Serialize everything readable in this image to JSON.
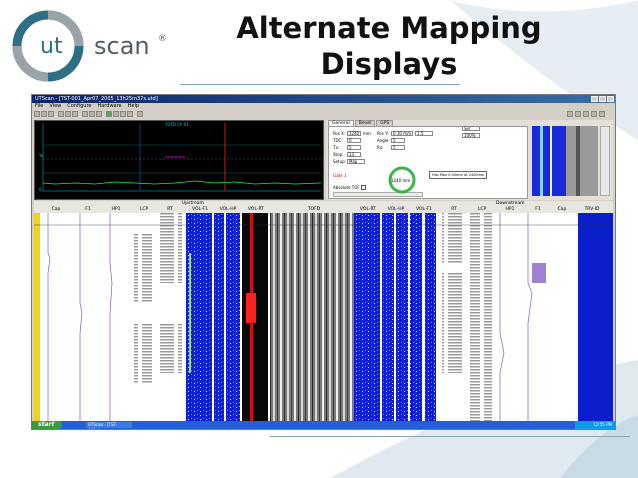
{
  "logo": {
    "ut": "ut",
    "scan": "scan",
    "reg": "®"
  },
  "slide": {
    "title_line1": "Alternate Mapping",
    "title_line2": "Displays"
  },
  "window": {
    "title": "UTScan - [TST-001_Apr07_2005_13h25m37s.utd]",
    "menu": [
      "File",
      "View",
      "Configure",
      "Hardware",
      "Help"
    ]
  },
  "panel": {
    "tabs": [
      "General",
      "Bevel",
      "GPS"
    ],
    "pos_x": {
      "label": "Pos X:",
      "value": "1240",
      "unit": "mm"
    },
    "pos_y": {
      "label": "Pos Y:",
      "value": "0.10 mm",
      "extra": "1.5"
    },
    "tdc": {
      "label": "TDC:",
      "value": "0"
    },
    "angle": {
      "label": "Angle:",
      "value": "5"
    },
    "tx": {
      "label": "Tx:",
      "value": "5"
    },
    "rx": {
      "label": "Rx:",
      "value": "5"
    },
    "step": {
      "label": "Step:",
      "value": "13"
    },
    "setup": {
      "label": "Setup:",
      "value": "Map"
    },
    "gate": "Gate 1",
    "absolute_tof": "Absolute TOF",
    "dial_value": "1240 mm",
    "dial_color": "#3ab54a",
    "info_box": "Hits Max 0.00mm at 2400mm",
    "dropdown1": "Sel",
    "dropdown2": "100%"
  },
  "scope": {
    "label_top": "TOFD Ch 01",
    "grid_color": "#00d0d0",
    "trace_color": "#00ff40"
  },
  "channels": {
    "group_upstream": "Upstream",
    "group_downstream": "Downstream",
    "labels": [
      "Cap",
      "F1",
      "HP1",
      "LCP",
      "RT",
      "VOL-F1",
      "VOL-HP",
      "VOL-RT",
      "TOFD",
      "VOL-RT",
      "VOL-HP",
      "VOL-F1",
      "RT",
      "LCP",
      "HP1",
      "F1",
      "Cap",
      "TRV-ID"
    ]
  },
  "taskbar": {
    "start": "start",
    "item": "UTScan - [TST-001_A...",
    "clock": "12:55 PM"
  },
  "colors": {
    "accent": "#2e6f86",
    "blue_map": "#0a1ecc",
    "red_map": "#d01010",
    "purple_trace": "#7a3ab8"
  }
}
